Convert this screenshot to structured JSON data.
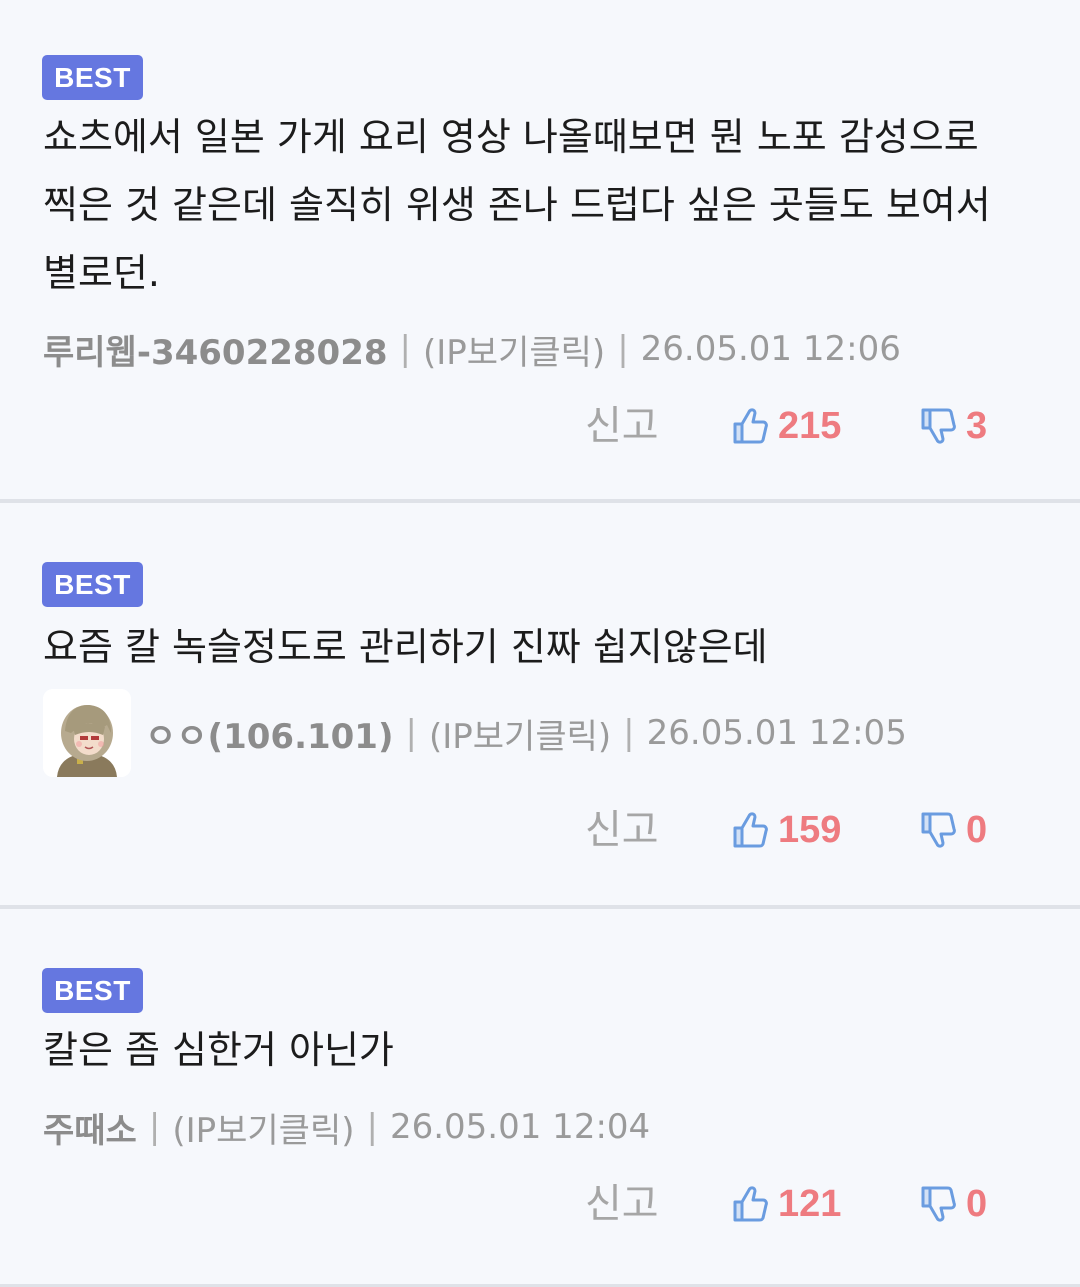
{
  "badge_label": "BEST",
  "report_label": "신고",
  "colors": {
    "badge_bg": "#6577e0",
    "count": "#ee7b80",
    "icon": "#6a9ce0",
    "divider": "#dfe2e8"
  },
  "comments": [
    {
      "text": "쇼츠에서 일본 가게 요리 영상 나올때보면 뭔 노포 감성으로 찍은 것 같은데 솔직히 위생 존나 드럽다 싶은 곳들도 보여서 별로던.",
      "author": "루리웹-3460228028",
      "ip": "(IP보기클릭)",
      "time": "26.05.01 12:06",
      "likes": "215",
      "dislikes": "3"
    },
    {
      "text": "요즘 칼 녹슬정도로 관리하기 진짜 쉽지않은데",
      "author": "ㅇㅇ(106.101)",
      "ip": "(IP보기클릭)",
      "time": "26.05.01 12:05",
      "likes": "159",
      "dislikes": "0"
    },
    {
      "text": "칼은 좀 심한거 아닌가",
      "author": "주때소",
      "ip": "(IP보기클릭)",
      "time": "26.05.01 12:04",
      "likes": "121",
      "dislikes": "0"
    }
  ]
}
